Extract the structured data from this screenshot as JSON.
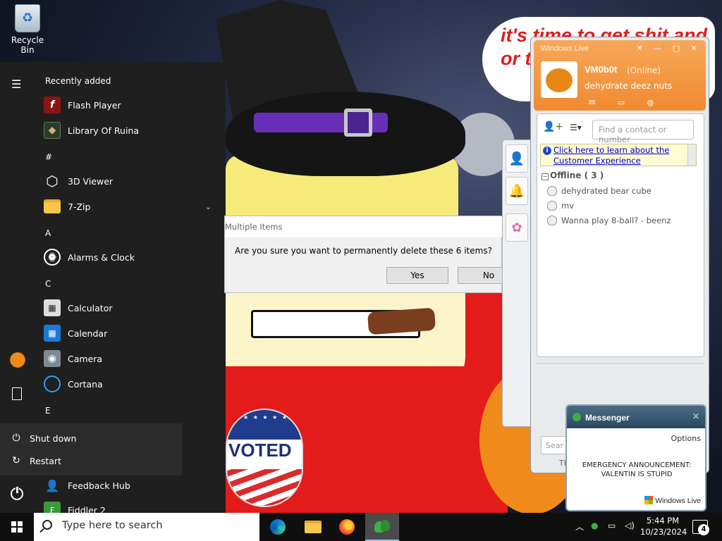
{
  "desktop": {
    "recycle_bin_label": "Recycle Bin",
    "speech_text": "it's time to get shit and or t"
  },
  "start_menu": {
    "recently_added_label": "Recently added",
    "sections": [
      "#",
      "A",
      "C",
      "E"
    ],
    "apps": {
      "flash_player": "Flash Player",
      "library_of_ruina": "Library Of Ruina",
      "viewer_3d": "3D Viewer",
      "zip7": "7-Zip",
      "alarms": "Alarms & Clock",
      "calculator": "Calculator",
      "calendar": "Calendar",
      "camera": "Camera",
      "cortana": "Cortana",
      "feedback_hub": "Feedback Hub",
      "fiddler": "Fiddler 2"
    },
    "power_menu": {
      "shutdown": "Shut down",
      "restart": "Restart"
    }
  },
  "dialog": {
    "title": "Multiple Items",
    "message": "Are you sure you want to permanently delete these 6 items?",
    "yes": "Yes",
    "no": "No"
  },
  "messenger": {
    "title": "Windows Live",
    "display_name": "VM0b0t",
    "status": "(Online)",
    "personal_message": "dehydrate deez nuts",
    "search_placeholder": "Find a contact or number",
    "info_link": "Click here to learn about the Customer Experience",
    "group_label": "Offline ( 3 )",
    "contacts": [
      "dehydrated bear cube",
      "mv",
      "Wanna play 8-ball? - beenz"
    ],
    "bottom_search": "Sear",
    "bottom_label": "Th"
  },
  "toast": {
    "title": "Messenger",
    "options": "Options",
    "message": "EMERGENCY ANNOUNCEMENT: VALENTIN IS STUPID",
    "brand": "Windows Live"
  },
  "taskbar": {
    "search_placeholder": "Type here to search",
    "time": "5:44 PM",
    "date": "10/23/2024",
    "notification_count": "4"
  },
  "colors": {
    "messenger_orange": "#f08a30",
    "start_bg": "#1f1f1f",
    "voted_blue": "#1d2f7a",
    "speech_red": "#e01c1c"
  },
  "icons": {
    "fiddler": "F"
  }
}
